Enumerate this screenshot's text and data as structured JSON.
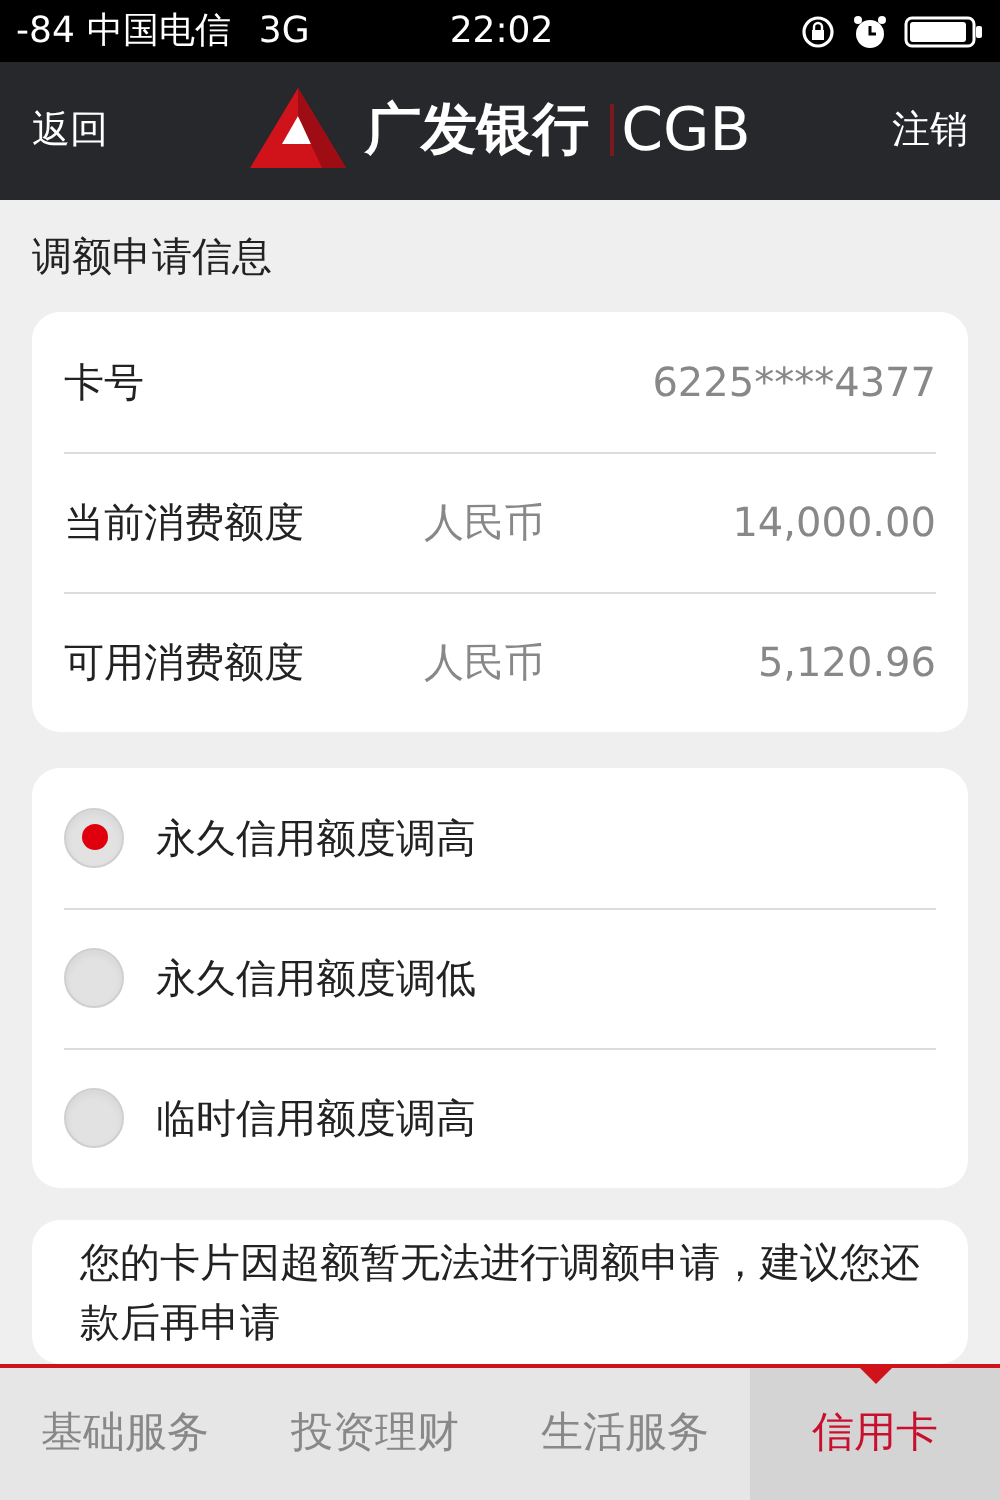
{
  "status_bar": {
    "signal": "-84",
    "carrier": "中国电信",
    "network": "3G",
    "time": "22:02"
  },
  "header": {
    "back": "返回",
    "brand_cn": "广发银行",
    "brand_en": "CGB",
    "logout": "注销"
  },
  "section_title": "调额申请信息",
  "info_rows": [
    {
      "label": "卡号",
      "value": "6225****4377"
    },
    {
      "label": "当前消费额度",
      "currency": "人民币",
      "value": "14,000.00"
    },
    {
      "label": "可用消费额度",
      "currency": "人民币",
      "value": "5,120.96"
    }
  ],
  "options": [
    {
      "label": "永久信用额度调高",
      "selected": true
    },
    {
      "label": "永久信用额度调低",
      "selected": false
    },
    {
      "label": "临时信用额度调高",
      "selected": false
    }
  ],
  "message": "您的卡片因超额暂无法进行调额申请，建议您还款后再申请",
  "tabs": [
    {
      "label": "基础服务",
      "selected": false
    },
    {
      "label": "投资理财",
      "selected": false
    },
    {
      "label": "生活服务",
      "selected": false
    },
    {
      "label": "信用卡",
      "selected": true
    }
  ]
}
